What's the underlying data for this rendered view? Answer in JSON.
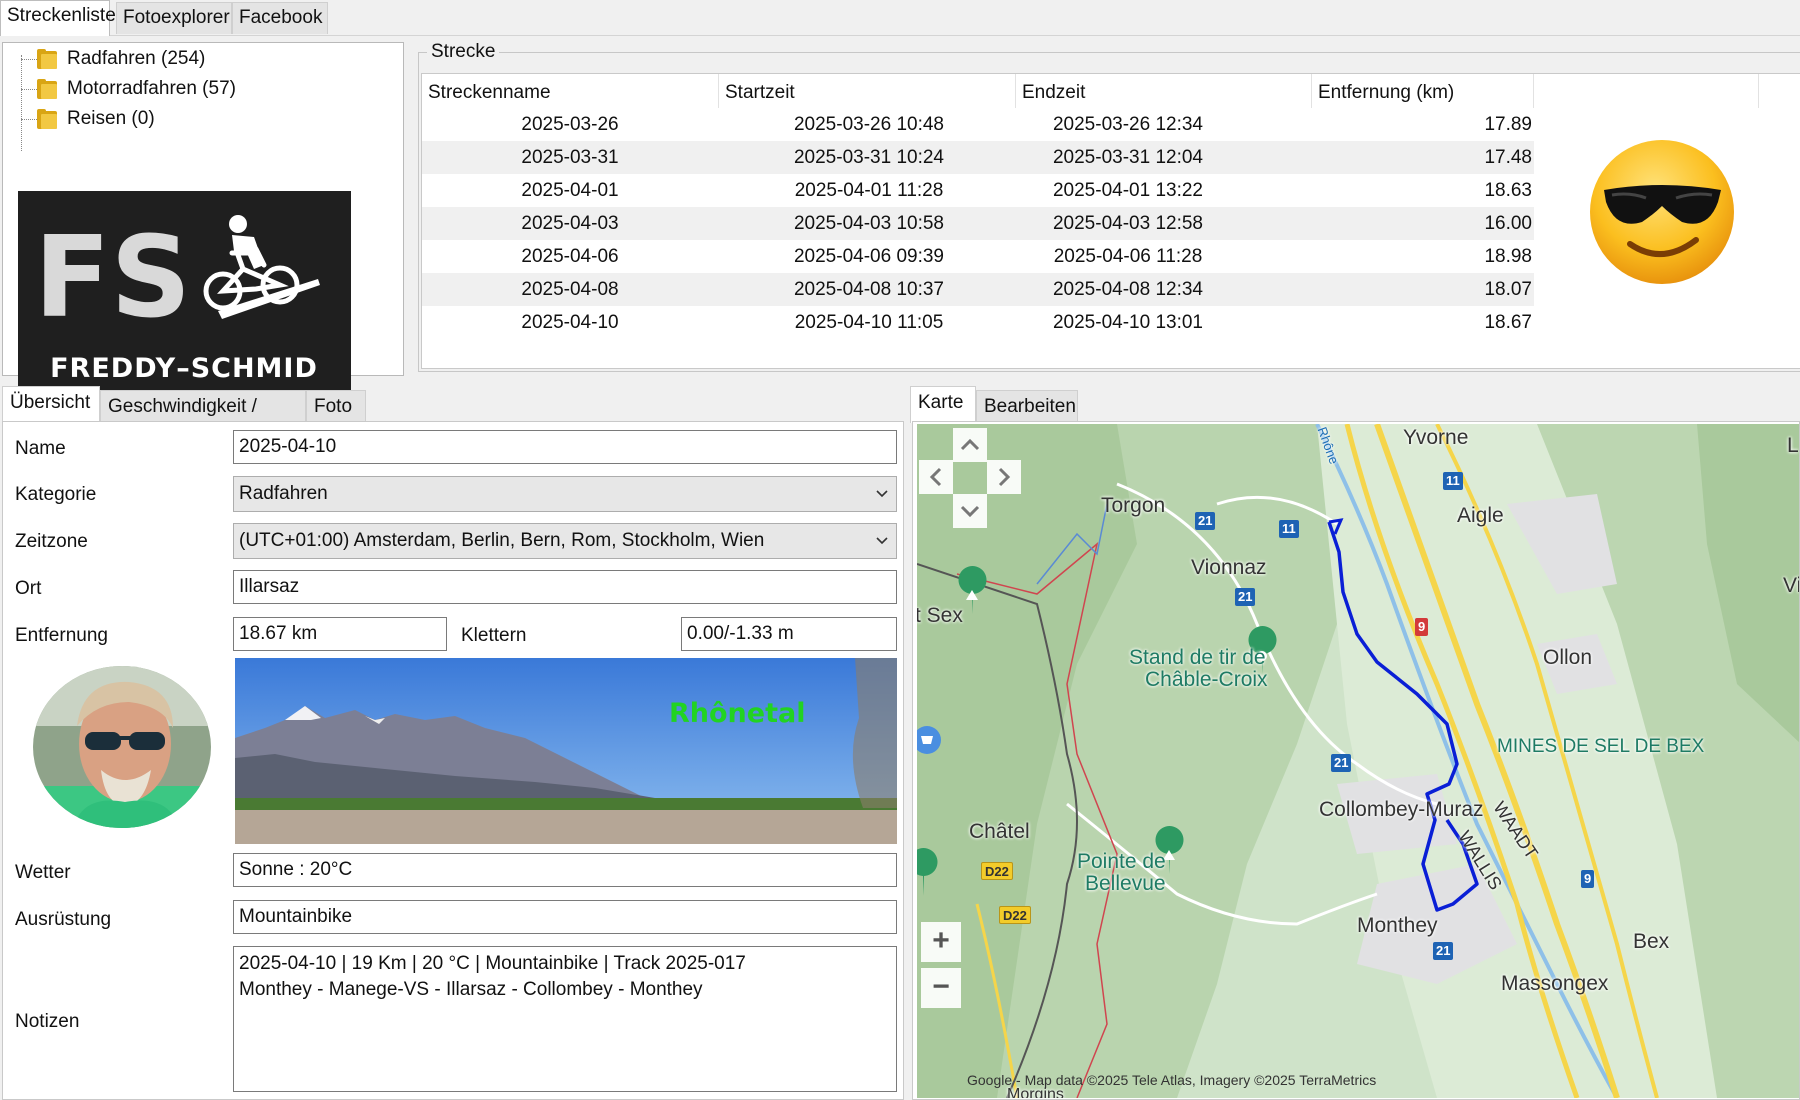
{
  "top_tabs": [
    "Streckenliste",
    "Fotoexplorer",
    "Facebook"
  ],
  "tree": [
    {
      "label": "Radfahren (254)"
    },
    {
      "label": "Motorradfahren (57)"
    },
    {
      "label": "Reisen (0)"
    }
  ],
  "logo": {
    "text": "FREDDY–SCHMID",
    "letters": "FS"
  },
  "strecke": {
    "title": "Strecke",
    "columns": [
      "Streckenname",
      "Startzeit",
      "Endzeit",
      "Entfernung (km)"
    ],
    "rows": [
      [
        "2025-03-26",
        "2025-03-26 10:48",
        "2025-03-26 12:34",
        "17.89"
      ],
      [
        "2025-03-31",
        "2025-03-31 10:24",
        "2025-03-31 12:04",
        "17.48"
      ],
      [
        "2025-04-01",
        "2025-04-01 11:28",
        "2025-04-01 13:22",
        "18.63"
      ],
      [
        "2025-04-03",
        "2025-04-03 10:58",
        "2025-04-03 12:58",
        "16.00"
      ],
      [
        "2025-04-06",
        "2025-04-06 09:39",
        "2025-04-06 11:28",
        "18.98"
      ],
      [
        "2025-04-08",
        "2025-04-08 10:37",
        "2025-04-08 12:34",
        "18.07"
      ],
      [
        "2025-04-10",
        "2025-04-10 11:05",
        "2025-04-10 13:01",
        "18.67"
      ]
    ]
  },
  "lower_tabs": [
    "Übersicht",
    "Geschwindigkeit / Höhe",
    "Foto"
  ],
  "map_tabs": [
    "Karte",
    "Bearbeiten"
  ],
  "form": {
    "name_label": "Name",
    "name_value": "2025-04-10",
    "kategorie_label": "Kategorie",
    "kategorie_value": "Radfahren",
    "zeitzone_label": "Zeitzone",
    "zeitzone_value": "(UTC+01:00) Amsterdam, Berlin, Bern, Rom, Stockholm, Wien",
    "ort_label": "Ort",
    "ort_value": "Illarsaz",
    "entfernung_label": "Entfernung",
    "entfernung_value": "18.67 km",
    "klettern_label": "Klettern",
    "klettern_value": "0.00/-1.33 m",
    "photo_caption": "Rhônetal",
    "wetter_label": "Wetter",
    "wetter_value": "Sonne  :  20°C",
    "ausruestung_label": "Ausrüstung",
    "ausruestung_value": "Mountainbike",
    "notizen_label": "Notizen",
    "notizen_line1": "2025-04-10  |  19 Km  |  20 °C  |  Mountainbike  |  Track 2025-017",
    "notizen_line2": "Monthey - Manege-VS - Illarsaz - Collombey - Monthey"
  },
  "map": {
    "labels": {
      "yvorne": "Yvorne",
      "aigle": "Aigle",
      "torgon": "Torgon",
      "vionnaz": "Vionnaz",
      "sex": "t Sex",
      "stand": "Stand de tir de",
      "chable": "Châble-Croix",
      "ollon": "Ollon",
      "mines": "MINES DE SEL DE BEX",
      "collombey": "Collombey-Muraz",
      "chatel": "Châtel",
      "pointe": "Pointe de",
      "bellevue": "Bellevue",
      "monthey": "Monthey",
      "bex": "Bex",
      "massongex": "Massongex",
      "waadt": "WAADT",
      "wallis": "WALLIS",
      "rhone": "Rhône",
      "edge_v": "Vi",
      "edge_l": "L",
      "morgins": "Morgins"
    },
    "badges": {
      "r11a": "11",
      "r11b": "11",
      "r21a": "21",
      "r21b": "21",
      "r21c": "21",
      "r21d": "21",
      "r9": "9",
      "r9b": "9",
      "d22a": "D22",
      "d22b": "D22"
    },
    "attribution": "Google - Map data ©2025 Tele Atlas, Imagery ©2025 TerraMetrics",
    "zoom_in": "+",
    "zoom_out": "−"
  },
  "colors": {
    "track": "#0a1fd6",
    "grass": "#cfe3c9",
    "road_yellow": "#f5d54a",
    "photo_label": "#22d322"
  }
}
